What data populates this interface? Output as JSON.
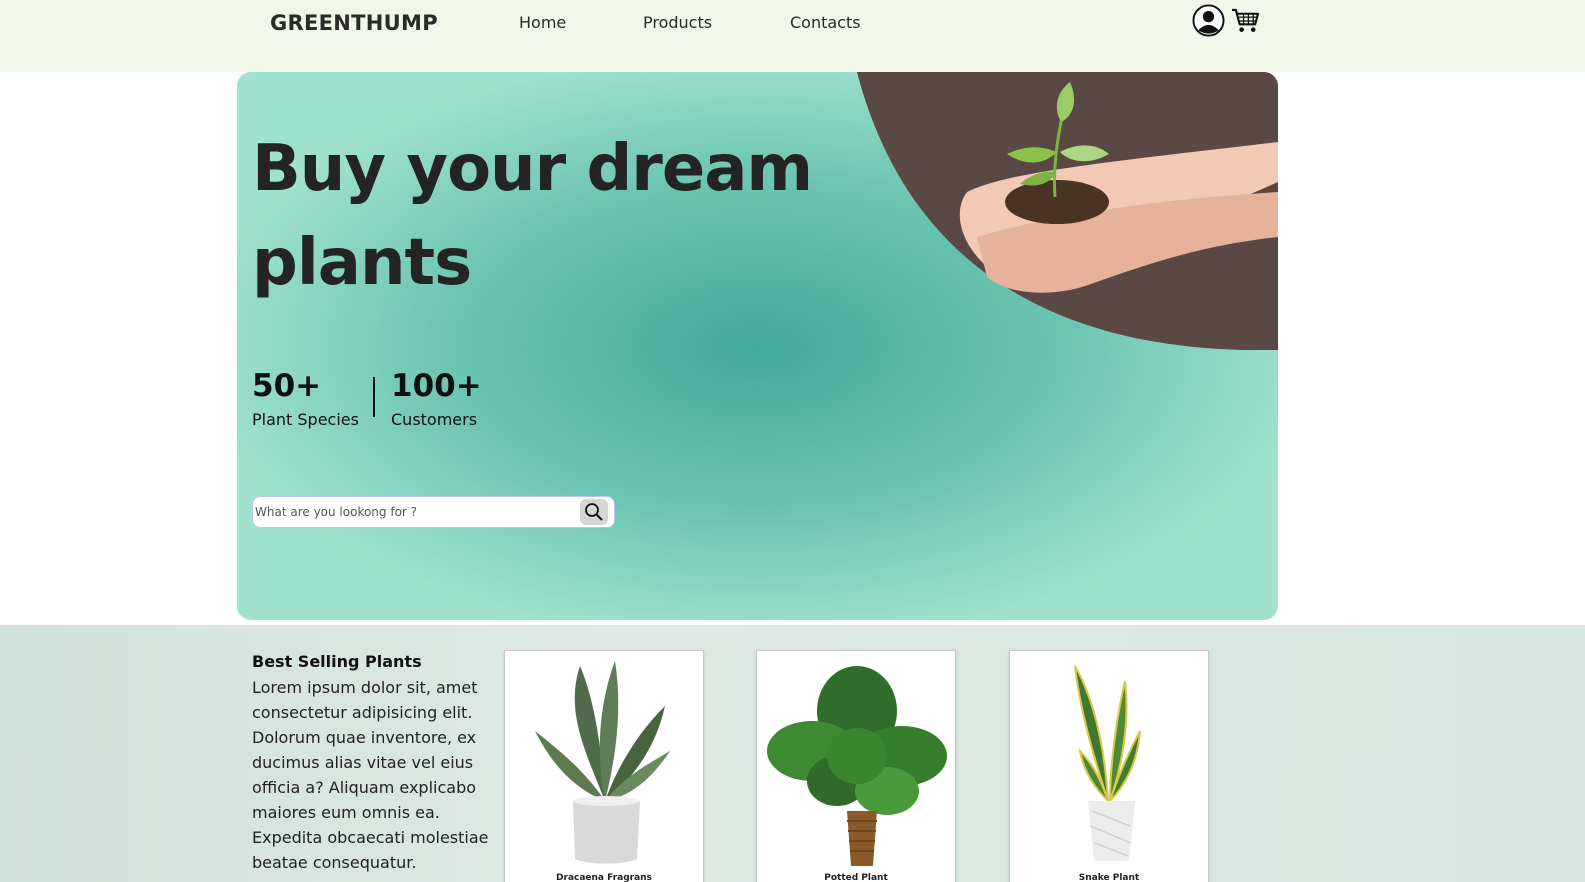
{
  "header": {
    "logo": "GREENTHUMP",
    "nav": [
      "Home",
      "Products",
      "Contacts"
    ],
    "icons": [
      "user-account-icon",
      "shopping-cart-icon"
    ]
  },
  "hero": {
    "title": "Buy your dream plants",
    "stats": [
      {
        "value": "50+",
        "label": "Plant Species"
      },
      {
        "value": "100+",
        "label": "Customers"
      }
    ],
    "search_placeholder": "What are you lookong for ?",
    "search_icon": "magnifier-icon",
    "image": "hands-holding-seedling"
  },
  "best_selling": {
    "title": "Best Selling Plants",
    "description": "Lorem ipsum dolor sit, amet consectetur adipisicing elit. Dolorum quae inventore, ex ducimus alias vitae vel eius officia a? Aliquam explicabo maiores eum omnis ea. Expedita obcaecati molestiae beatae consequatur.",
    "products": [
      {
        "name": "Dracaena Fragrans"
      },
      {
        "name": "Potted Plant"
      },
      {
        "name": "Snake Plant"
      }
    ]
  },
  "colors": {
    "header_bg": "#f0f6e8",
    "hero_center": "#45a89a",
    "hero_edge": "#a0e2cd",
    "hero_art_bg": "#5a4845",
    "section_bg": "#d4e6df"
  }
}
